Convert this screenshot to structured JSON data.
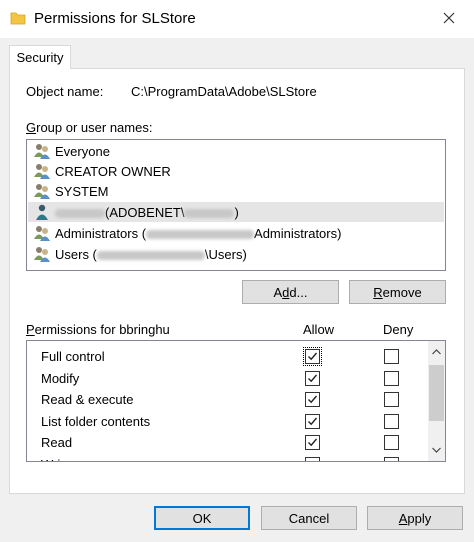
{
  "window": {
    "title": "Permissions for SLStore"
  },
  "tabs": [
    {
      "label": "Security"
    }
  ],
  "object": {
    "label": "Object name:",
    "value": "C:\\ProgramData\\Adobe\\SLStore"
  },
  "group": {
    "label": "Group or user names:",
    "users": [
      {
        "name": "Everyone",
        "icon": "group-icon"
      },
      {
        "name": "CREATOR OWNER",
        "icon": "group-icon"
      },
      {
        "name": "SYSTEM",
        "icon": "group-icon"
      },
      {
        "name_middle": "(ADOBENET\\",
        "name_suffix": ")",
        "icon": "user-icon",
        "selected": true
      },
      {
        "name": "Administrators (",
        "name_suffix": "Administrators)",
        "icon": "group-icon"
      },
      {
        "name": "Users (",
        "name_suffix": "\\Users)",
        "icon": "group-icon"
      }
    ]
  },
  "buttons": {
    "add": "Add...",
    "remove": "Remove",
    "ok": "OK",
    "cancel": "Cancel",
    "apply": "Apply"
  },
  "permissions": {
    "label": "Permissions for bbringhu",
    "allow_header": "Allow",
    "deny_header": "Deny",
    "rows": [
      {
        "name": "Full control",
        "allow": true,
        "deny": false
      },
      {
        "name": "Modify",
        "allow": true,
        "deny": false
      },
      {
        "name": "Read & execute",
        "allow": true,
        "deny": false
      },
      {
        "name": "List folder contents",
        "allow": true,
        "deny": false
      },
      {
        "name": "Read",
        "allow": true,
        "deny": false
      },
      {
        "name": "Wri",
        "allow": false,
        "deny": false
      }
    ]
  },
  "colors": {
    "accent": "#0078d7",
    "selection": "#e5e5e5",
    "folder": "#f4c542"
  }
}
